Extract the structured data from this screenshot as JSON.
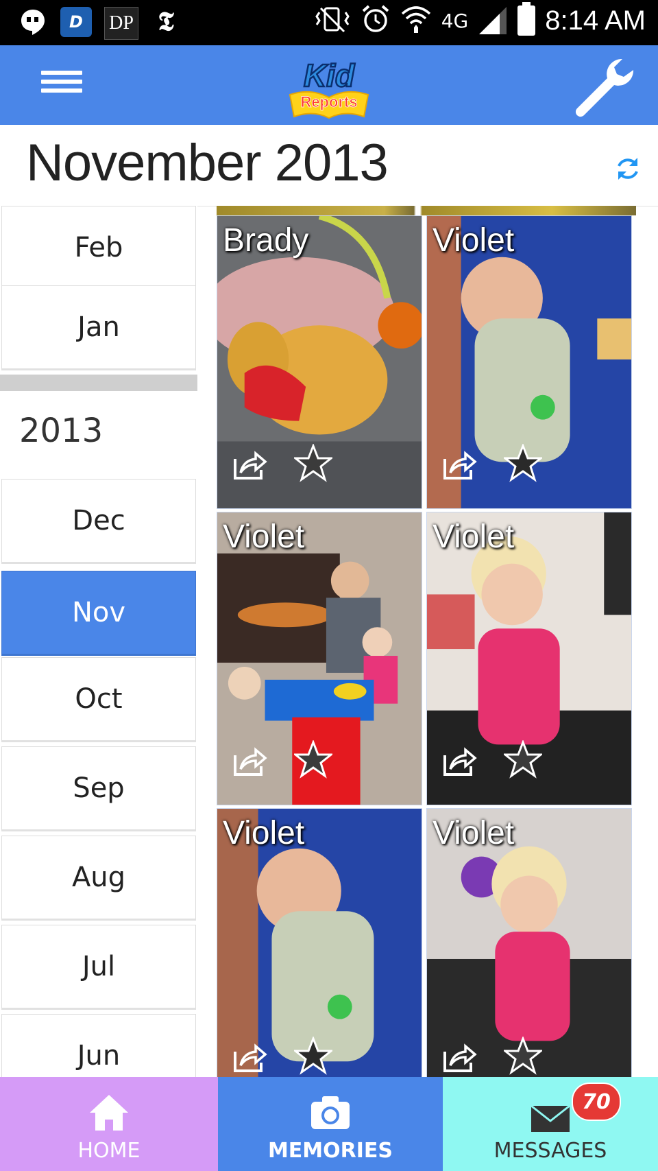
{
  "status_bar": {
    "time": "8:14 AM",
    "network": "4G",
    "left_icons": [
      "hangouts-icon",
      "d-app-icon",
      "dp-app-icon",
      "nyt-icon"
    ],
    "dp_label": "DP",
    "nyt_label": "𝕿",
    "d_label": "D"
  },
  "app_bar": {
    "logo_text": "Kid Reports",
    "logo_word1": "Kid",
    "logo_word2": "Reports",
    "menu_icon": "hamburger-menu-icon",
    "settings_icon": "wrench-icon"
  },
  "title": "November 2013",
  "sidebar": {
    "months_top": [
      {
        "label": "Feb"
      },
      {
        "label": "Jan"
      }
    ],
    "year": "2013",
    "months": [
      {
        "label": "Dec",
        "selected": false
      },
      {
        "label": "Nov",
        "selected": true
      },
      {
        "label": "Oct",
        "selected": false
      },
      {
        "label": "Sep",
        "selected": false
      },
      {
        "label": "Aug",
        "selected": false
      },
      {
        "label": "Jul",
        "selected": false
      },
      {
        "label": "Jun",
        "selected": false
      }
    ]
  },
  "photos": [
    {
      "name": "Brady"
    },
    {
      "name": "Violet"
    },
    {
      "name": "Violet"
    },
    {
      "name": "Violet"
    },
    {
      "name": "Violet"
    },
    {
      "name": "Violet"
    }
  ],
  "bottom_nav": {
    "home_label": "HOME",
    "memories_label": "MEMORIES",
    "messages_label": "MESSAGES",
    "messages_badge": "70"
  },
  "colors": {
    "accent_blue": "#4a86e8",
    "home_tab": "#d59bf7",
    "messages_tab": "#8ff8f2",
    "badge_red": "#e53935"
  }
}
